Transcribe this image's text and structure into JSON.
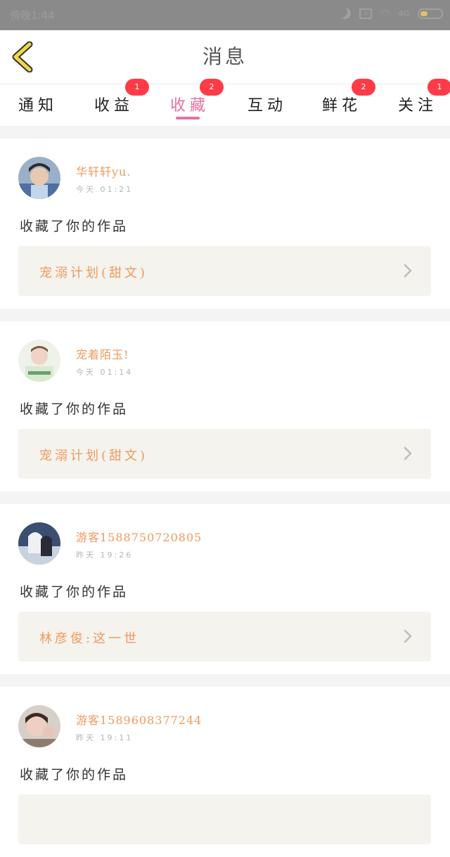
{
  "status_bar": {
    "carrier": "傍晚1:44",
    "network": "4G"
  },
  "header": {
    "title": "消息",
    "back_icon": "back-arrow-icon"
  },
  "tabs": [
    {
      "label": "通知",
      "badge": ""
    },
    {
      "label": "收益",
      "badge": "1"
    },
    {
      "label": "收藏",
      "badge": "2",
      "active": true
    },
    {
      "label": "互动",
      "badge": ""
    },
    {
      "label": "鲜花",
      "badge": "2"
    },
    {
      "label": "关注",
      "badge": "1"
    }
  ],
  "messages": [
    {
      "user": "华轩轩yu.",
      "time": "今天 01:21",
      "action": "收藏了你的作品",
      "work": "宠溺计划(甜文)"
    },
    {
      "user": "宠着陌玉!",
      "time": "今天 01:14",
      "action": "收藏了你的作品",
      "work": "宠溺计划(甜文)"
    },
    {
      "user": "游客1588750720805",
      "time": "昨天 19:26",
      "action": "收藏了你的作品",
      "work": "林彦俊:这一世"
    },
    {
      "user": "游客1589608377244",
      "time": "昨天 19:11",
      "action": "收藏了你的作品",
      "work": ""
    }
  ],
  "colors": {
    "accent_pink": "#e86fa4",
    "orange": "#ef9a5d",
    "badge_red": "#ff3b47",
    "back_yellow": "#f0d64a"
  }
}
